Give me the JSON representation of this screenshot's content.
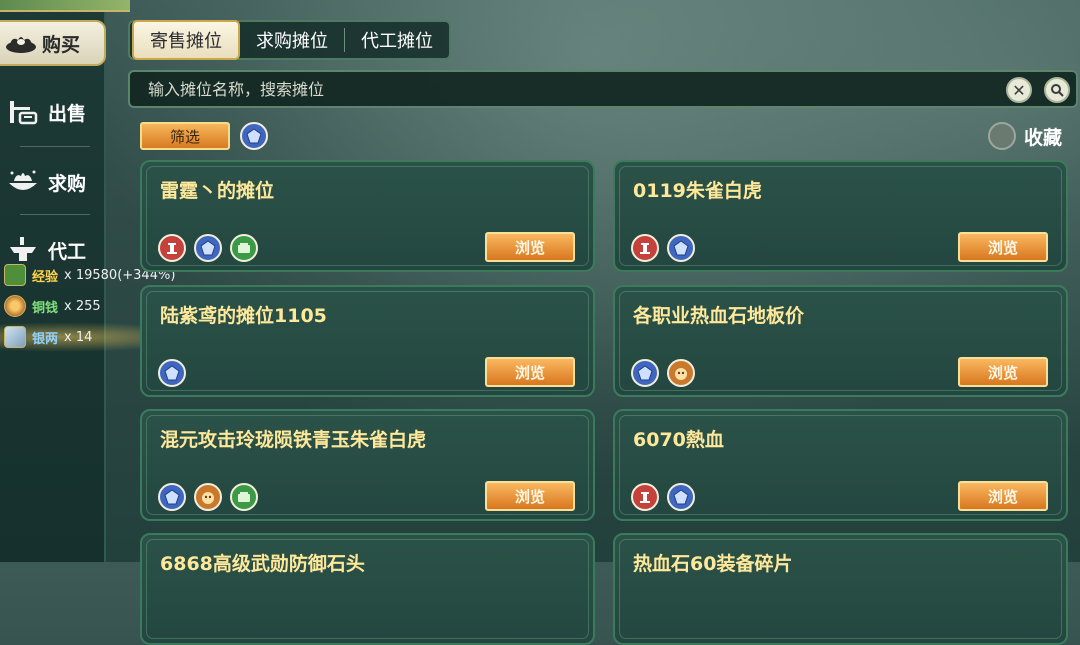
{
  "sidebar": {
    "buy_label": "购买",
    "items": [
      {
        "label": "出售"
      },
      {
        "label": "求购"
      },
      {
        "label": "代工"
      }
    ]
  },
  "rewards": [
    {
      "name": "经验",
      "qty": "x 19580(+344%)",
      "name_color": "#ffd34a"
    },
    {
      "name": "铜钱",
      "qty": "x 255",
      "name_color": "#7fe07a"
    },
    {
      "name": "银两",
      "qty": "x 14",
      "name_color": "#8fd0ff"
    }
  ],
  "tabs": [
    {
      "label": "寄售摊位",
      "active": true
    },
    {
      "label": "求购摊位",
      "active": false
    },
    {
      "label": "代工摊位",
      "active": false
    }
  ],
  "search": {
    "placeholder": "输入摊位名称，搜索摊位",
    "value": ""
  },
  "filter": {
    "label": "筛选"
  },
  "favorite": {
    "label": "收藏"
  },
  "browse_label": "浏览",
  "stalls": [
    {
      "title": "雷霆丶的摊位",
      "icons": [
        "red",
        "blue",
        "green"
      ]
    },
    {
      "title": "0119朱雀白虎",
      "icons": [
        "red",
        "blue"
      ]
    },
    {
      "title": "陆紫鸢的摊位1105",
      "icons": [
        "blue"
      ]
    },
    {
      "title": "各职业热血石地板价",
      "icons": [
        "blue",
        "orange"
      ]
    },
    {
      "title": "混元攻击玲珑陨铁青玉朱雀白虎",
      "icons": [
        "blue",
        "orange",
        "green"
      ]
    },
    {
      "title": "6070熱血",
      "icons": [
        "red",
        "blue"
      ]
    },
    {
      "title": "6868高级武勋防御石头",
      "icons": []
    },
    {
      "title": "热血石60装备碎片",
      "icons": []
    }
  ],
  "colors": {
    "accent": "#d8771f",
    "title_text": "#ffe89a",
    "card_bg": "#2b5248"
  }
}
